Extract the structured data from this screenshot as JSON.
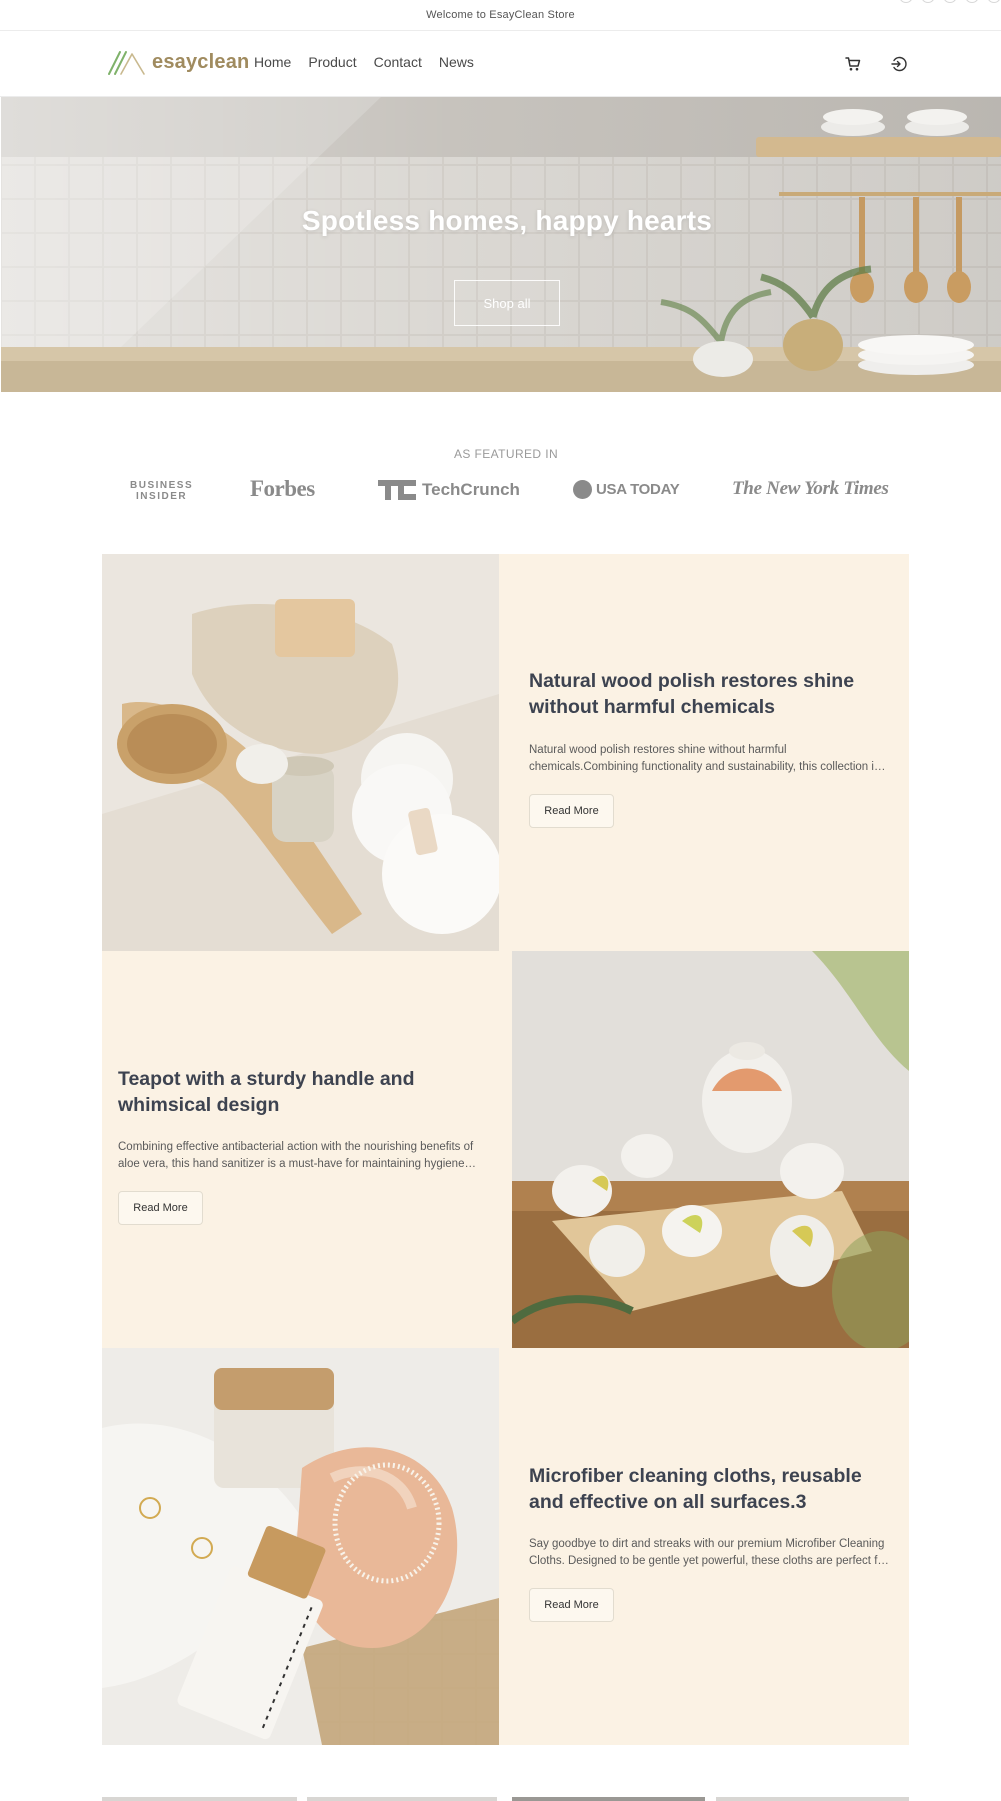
{
  "announcement": {
    "text": "Welcome to EsayClean Store"
  },
  "header": {
    "logo_text": "esayclean",
    "nav": [
      {
        "label": "Home"
      },
      {
        "label": "Product"
      },
      {
        "label": "Contact"
      },
      {
        "label": "News"
      }
    ],
    "icons": {
      "cart": "cart-icon",
      "login": "login-icon"
    }
  },
  "hero": {
    "title": "Spotless homes, happy hearts",
    "button_label": "Shop all"
  },
  "featured": {
    "label": "AS FEATURED IN",
    "logos": {
      "business_insider_line1": "BUSINESS",
      "business_insider_line2": "INSIDER",
      "forbes": "Forbes",
      "techcrunch": "TechCrunch",
      "usatoday": "USA TODAY",
      "nyt": "The New York Times"
    }
  },
  "features": [
    {
      "title": "Natural wood polish restores shine without harmful chemicals",
      "description": "Natural wood polish restores shine without harmful chemicals.Combining functionality and sustainability, this collection is designed for everyday use.",
      "button_label": "Read More"
    },
    {
      "title": "Teapot with a sturdy handle and whimsical design",
      "description": "Combining effective antibacterial action with the nourishing benefits of aloe vera, this hand sanitizer is a must-have for maintaining hygiene on the go.",
      "button_label": "Read More"
    },
    {
      "title": "Microfiber cleaning cloths, reusable and effective on all surfaces.3",
      "description": "Say goodbye to dirt and streaks with our premium Microfiber Cleaning Cloths. Designed to be gentle yet powerful, these cloths are perfect for every surface.",
      "button_label": "Read More"
    }
  ],
  "colors": {
    "panel_bg": "#fbf2e4",
    "logo_gold": "#a08b5f",
    "logo_green": "#7fb26a",
    "heading": "#3d4350"
  }
}
